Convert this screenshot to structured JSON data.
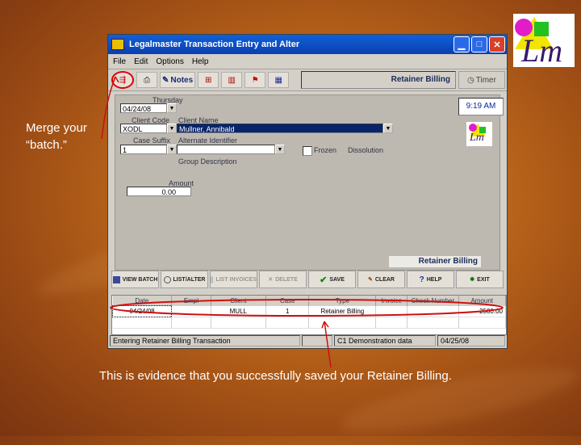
{
  "slide": {
    "caption_left": "Merge your “batch.”",
    "caption_bottom": "This is evidence that you successfully saved your Retainer Billing.",
    "logo_text": "Lm"
  },
  "window": {
    "title": "Legalmaster Transaction Entry and Alter",
    "menu": [
      "File",
      "Edit",
      "Options",
      "Help"
    ],
    "toolbar": {
      "merge_icon": "merge-batch-icon",
      "print_icon": "print-icon",
      "notes_label": "Notes",
      "mode_title": "Retainer Billing",
      "timer_label": "Timer"
    },
    "form": {
      "day_label": "Thursday",
      "date_value": "04/24/08",
      "client_code_label": "Client Code",
      "client_code_value": "XODL",
      "client_name_label": "Client Name",
      "client_name_value": "Mullner, Annibald",
      "case_suffix_label": "Case Suffix",
      "case_suffix_value": "1",
      "alt_identifier_label": "Alternate Identifier",
      "frozen_label": "Frozen",
      "dissolution_label": "Dissolution",
      "group_desc_label": "Group Description",
      "amount_label": "Amount",
      "amount_value": "0.00",
      "time_value": "9:19 AM",
      "retainer_banner": "Retainer Billing"
    },
    "actions": [
      {
        "label": "VIEW BATCH",
        "enabled": true
      },
      {
        "label": "LIST/ALTER",
        "enabled": true
      },
      {
        "label": "LIST INVOICES",
        "enabled": false
      },
      {
        "label": "DELETE",
        "enabled": false
      },
      {
        "label": "SAVE",
        "enabled": true
      },
      {
        "label": "CLEAR",
        "enabled": true
      },
      {
        "label": "HELP",
        "enabled": true
      },
      {
        "label": "EXIT",
        "enabled": true
      }
    ],
    "grid": {
      "columns": [
        "Date",
        "Empl",
        "Client",
        "Case",
        "Type",
        "Invoice",
        "Check Number",
        "Amount"
      ],
      "rows": [
        [
          "04/24/08",
          "",
          "MULL",
          "1",
          "Retainer Billing",
          "",
          "",
          "2500.00"
        ]
      ]
    },
    "status": {
      "message": "Entering Retainer Billing Transaction",
      "database": "C1 Demonstration data",
      "date": "04/25/08"
    }
  },
  "colors": {
    "annotation": "#cc1010",
    "title_bar": "#0a3fb0",
    "selection": "#08246b"
  }
}
